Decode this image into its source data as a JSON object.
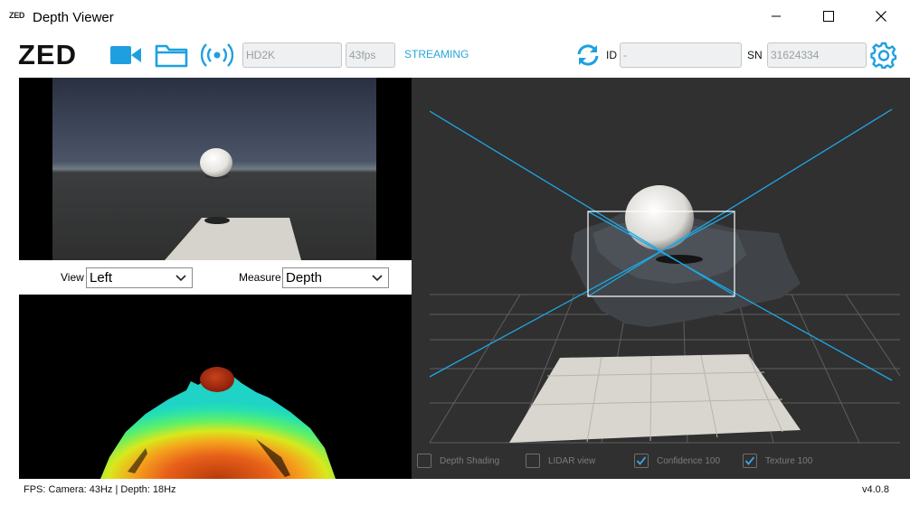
{
  "window": {
    "app_logo": "ZED",
    "title": "Depth Viewer"
  },
  "toolbar": {
    "logo": "ZED",
    "resolution": "HD2K",
    "fps": "43fps",
    "stream_status": "STREAMING",
    "id_label": "ID",
    "id_value": "-",
    "sn_label": "SN",
    "sn_value": "31624334"
  },
  "controls": {
    "view_label": "View",
    "view_value": "Left",
    "measure_label": "Measure",
    "measure_value": "Depth"
  },
  "options": [
    {
      "label": "Depth Shading",
      "checked": false
    },
    {
      "label": "LIDAR view",
      "checked": false
    },
    {
      "label": "Confidence 100",
      "checked": true
    },
    {
      "label": "Texture 100",
      "checked": true
    }
  ],
  "status": {
    "fps": "FPS: Camera: 43Hz | Depth: 18Hz",
    "version": "v4.0.8"
  },
  "colors": {
    "accent": "#1ea0e0",
    "stream_text": "#2aa6d9",
    "pointcloud_bg": "#303030"
  }
}
